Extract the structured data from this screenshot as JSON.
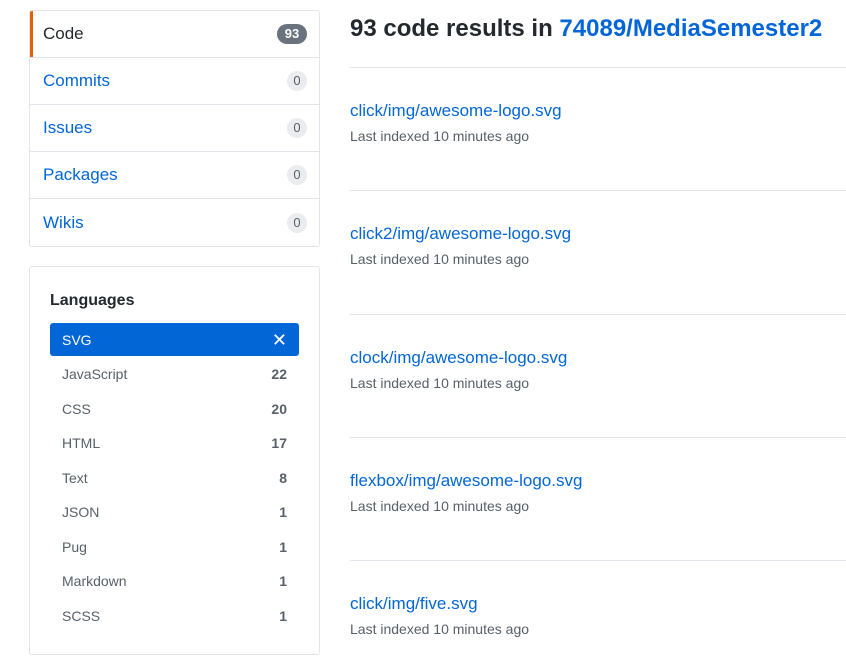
{
  "nav": {
    "items": [
      {
        "label": "Code",
        "count": "93",
        "selected": true
      },
      {
        "label": "Commits",
        "count": "0",
        "selected": false
      },
      {
        "label": "Issues",
        "count": "0",
        "selected": false
      },
      {
        "label": "Packages",
        "count": "0",
        "selected": false
      },
      {
        "label": "Wikis",
        "count": "0",
        "selected": false
      }
    ]
  },
  "languages": {
    "title": "Languages",
    "selected": {
      "label": "SVG",
      "clear_icon": "close-icon"
    },
    "items": [
      {
        "label": "JavaScript",
        "count": "22"
      },
      {
        "label": "CSS",
        "count": "20"
      },
      {
        "label": "HTML",
        "count": "17"
      },
      {
        "label": "Text",
        "count": "8"
      },
      {
        "label": "JSON",
        "count": "1"
      },
      {
        "label": "Pug",
        "count": "1"
      },
      {
        "label": "Markdown",
        "count": "1"
      },
      {
        "label": "SCSS",
        "count": "1"
      }
    ]
  },
  "header": {
    "prefix": "93 code results in ",
    "repo": "74089/MediaSemester2"
  },
  "results": [
    {
      "path": "click/img/awesome-logo.svg",
      "meta": "Last indexed 10 minutes ago"
    },
    {
      "path": "click2/img/awesome-logo.svg",
      "meta": "Last indexed 10 minutes ago"
    },
    {
      "path": "clock/img/awesome-logo.svg",
      "meta": "Last indexed 10 minutes ago"
    },
    {
      "path": "flexbox/img/awesome-logo.svg",
      "meta": "Last indexed 10 minutes ago"
    },
    {
      "path": "click/img/five.svg",
      "meta": "Last indexed 10 minutes ago"
    }
  ],
  "colors": {
    "link": "#0366d6",
    "selected_accent": "#e36209",
    "selected_language_bg": "#0366d6"
  }
}
